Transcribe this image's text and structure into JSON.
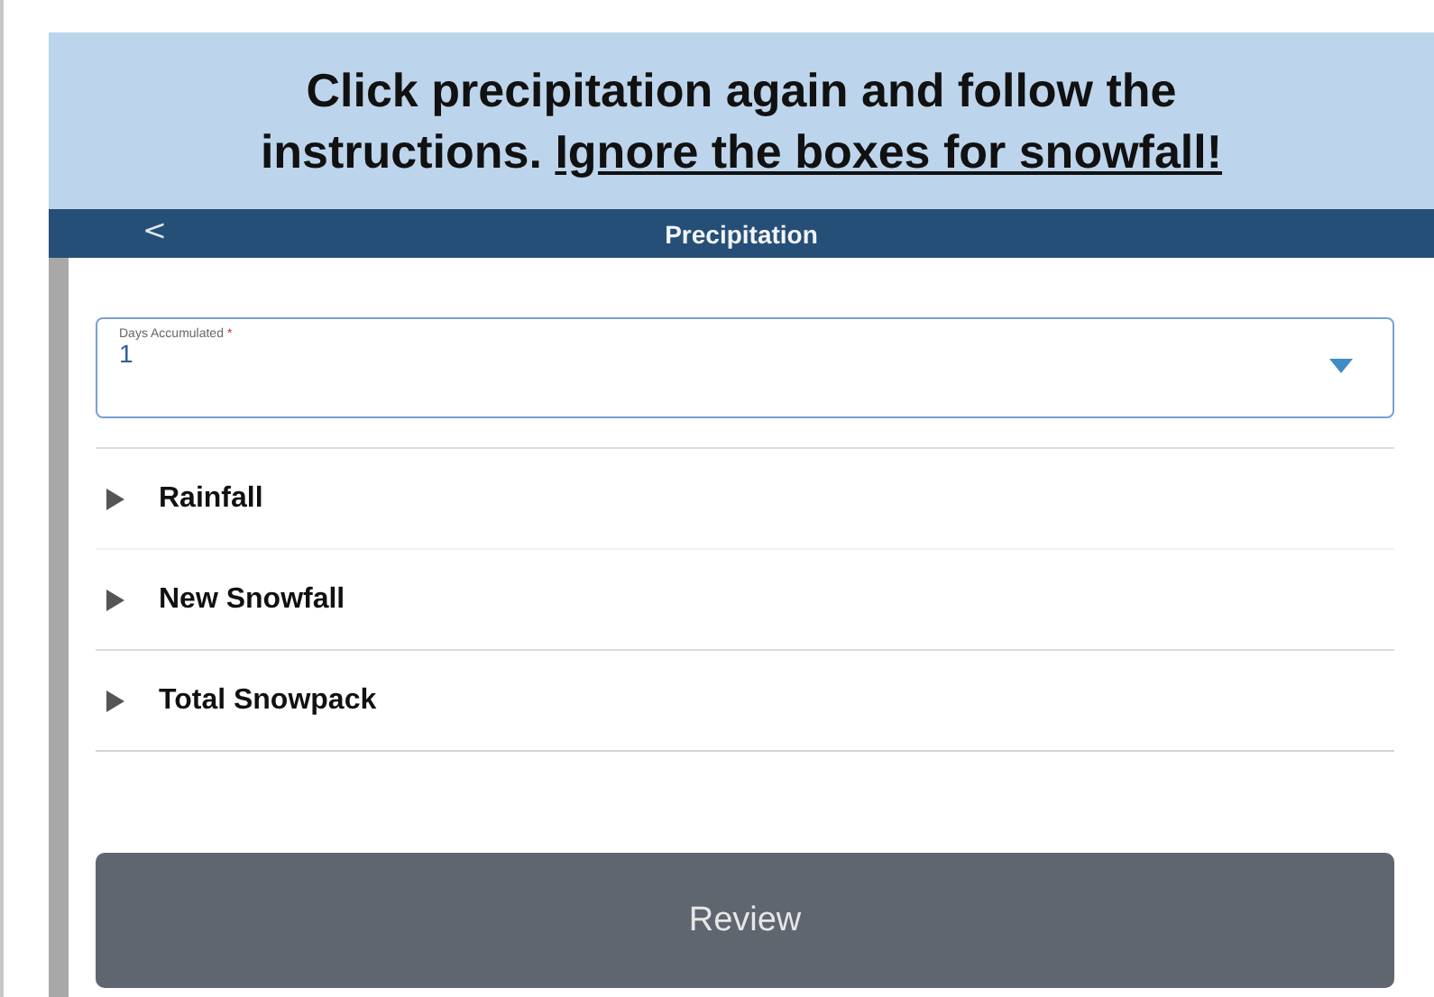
{
  "instruction": {
    "text": "Click precipitation again and follow the instructions.",
    "emphasis": "Ignore the boxes for snowfall!"
  },
  "header": {
    "back": "<",
    "title": "Precipitation"
  },
  "days_field": {
    "label": "Days Accumulated",
    "required_mark": "*",
    "value": "1"
  },
  "sections": [
    {
      "label": "Rainfall",
      "expanded": false
    },
    {
      "label": "New Snowfall",
      "expanded": false
    },
    {
      "label": "Total Snowpack",
      "expanded": false
    }
  ],
  "review_button": {
    "label": "Review",
    "disabled": true
  }
}
